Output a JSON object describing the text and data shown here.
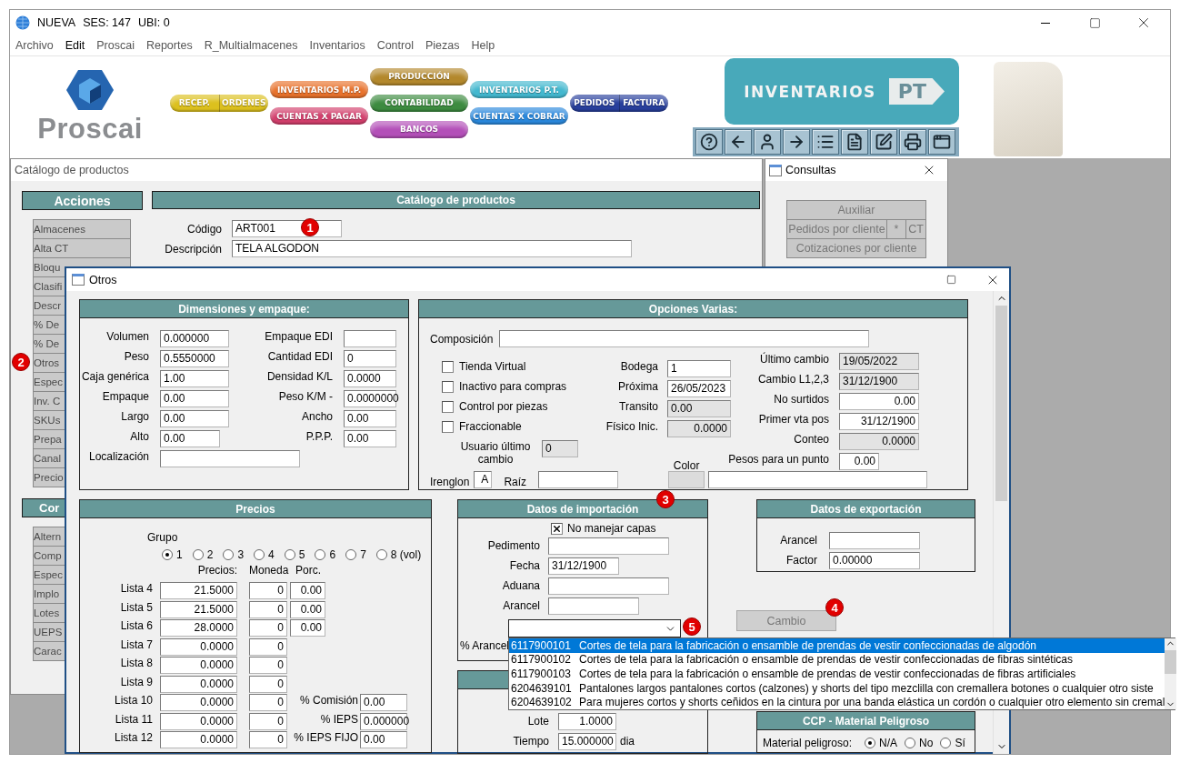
{
  "window": {
    "title": "NUEVA",
    "session": "SES: 147",
    "location": "UBI: 0"
  },
  "menu": [
    {
      "label": "Archivo",
      "disabled": true
    },
    {
      "label": "Edit",
      "disabled": false
    },
    {
      "label": "Proscai",
      "disabled": true
    },
    {
      "label": "Reportes",
      "disabled": true
    },
    {
      "label": "R_Multialmacenes",
      "disabled": true
    },
    {
      "label": "Inventarios",
      "disabled": true
    },
    {
      "label": "Control",
      "disabled": true
    },
    {
      "label": "Piezas",
      "disabled": true
    },
    {
      "label": "Help",
      "disabled": true
    }
  ],
  "logo": {
    "text": "Proscai"
  },
  "modules": [
    {
      "buttons": [
        {
          "labels": [
            "RECEP.",
            "ORDENES"
          ],
          "color": "#dcc01e"
        }
      ]
    },
    {
      "buttons": [
        {
          "labels": [
            "INVENTARIOS M.P."
          ],
          "color": "#e8722c"
        },
        {
          "labels": [
            "CUENTAS X PAGAR"
          ],
          "color": "#d23f6c"
        }
      ]
    },
    {
      "buttons": [
        {
          "labels": [
            "PRODUCCIÓN"
          ],
          "color": "#b3882c"
        },
        {
          "labels": [
            "CONTABILIDAD"
          ],
          "color": "#3d8b40"
        },
        {
          "labels": [
            "BANCOS"
          ],
          "color": "#b34fb8"
        }
      ]
    },
    {
      "buttons": [
        {
          "labels": [
            "INVENTARIOS P.T."
          ],
          "color": "#43b8cf"
        },
        {
          "labels": [
            "CUENTAS X COBRAR"
          ],
          "color": "#2a88dc"
        }
      ]
    },
    {
      "buttons": [
        {
          "labels": [
            "PEDIDOS",
            "FACTURA"
          ],
          "color": "#283f9c"
        }
      ]
    }
  ],
  "banner": {
    "title": "INVENTARIOS",
    "tag": "PT"
  },
  "catalog": {
    "title": "Catálogo de productos",
    "actions_header": "Acciones",
    "form_header": "Catálogo de productos",
    "actions": [
      {
        "label": "Almacenes"
      },
      {
        "label": "Alta CT"
      },
      {
        "label": "Bloqu"
      },
      {
        "label": "Clasifi"
      },
      {
        "label": "Descr"
      },
      {
        "label": "% De"
      },
      {
        "label": "% De"
      },
      {
        "label": "Otros",
        "badge": "2"
      },
      {
        "label": "Espec"
      },
      {
        "label": "Inv. C"
      },
      {
        "label": "SKUs"
      },
      {
        "label": "Prepa"
      },
      {
        "label": "Canal"
      },
      {
        "label": "Precio"
      }
    ],
    "second_header": "Cor",
    "second_actions": [
      {
        "label": "Altern"
      },
      {
        "label": "Comp"
      },
      {
        "label": "Espec"
      },
      {
        "label": "Implo"
      },
      {
        "label": "Lotes"
      },
      {
        "label": "UEPS"
      },
      {
        "label": "Carac"
      }
    ],
    "fields": [
      {
        "label": "Código",
        "value": "ART001",
        "badge": "1"
      },
      {
        "label": "Descripción",
        "value": "TELA ALGODON"
      }
    ]
  },
  "consultas": {
    "title": "Consultas",
    "rows": [
      [
        {
          "text": "Auxiliar"
        }
      ],
      [
        {
          "text": "Pedidos por cliente"
        },
        {
          "text": "*"
        },
        {
          "text": "CT"
        }
      ],
      [
        {
          "text": "Cotizaciones por cliente"
        }
      ]
    ]
  },
  "dialog": {
    "title": "Otros",
    "dimensions": {
      "title": "Dimensiones y empaque:",
      "left": [
        {
          "label": "Volumen",
          "value": "0.000000"
        },
        {
          "label": "Peso",
          "value": "0.5550000"
        },
        {
          "label": "Caja genérica",
          "value": "1.00"
        },
        {
          "label": "Empaque",
          "value": "0.00"
        },
        {
          "label": "Largo",
          "value": "0.00"
        },
        {
          "label": "Alto",
          "value": "0.00"
        }
      ],
      "right": [
        {
          "label": "Empaque EDI"
        },
        {
          "label": "Cantidad EDI",
          "value": "0"
        },
        {
          "label": "Densidad K/L",
          "value": "0.0000"
        },
        {
          "label": "Peso K/M -",
          "value": "0.0000000"
        },
        {
          "label": "Ancho",
          "value": "0.00"
        },
        {
          "label": "P.P.P.",
          "value": "0.00"
        }
      ],
      "location": {
        "label": "Localización"
      }
    },
    "options": {
      "title": "Opciones Varias:",
      "composition": {
        "label": "Composición"
      },
      "checks": [
        {
          "label": "Tienda Virtual",
          "checked": false
        },
        {
          "label": "Inactivo para compras",
          "checked": false
        },
        {
          "label": "Control por piezas",
          "checked": false
        },
        {
          "label": "Fraccionable",
          "checked": false
        }
      ],
      "user": {
        "label": "Usuario último cambio",
        "value": "0",
        "disabled": true
      },
      "middle": [
        {
          "label": "Bodega",
          "value": "1",
          "disabled": false
        },
        {
          "label": "Próxima",
          "value": "26/05/2023",
          "disabled": false
        },
        {
          "label": "Transito",
          "value": "0.00",
          "disabled": true
        },
        {
          "label": "Físico Inic.",
          "value": "0.0000",
          "disabled": true
        }
      ],
      "right": [
        {
          "label": "Último cambio",
          "value": "19/05/2022",
          "disabled": true
        },
        {
          "label": "Cambio L1,2,3",
          "value": "31/12/1900",
          "disabled": true
        },
        {
          "label": "No surtidos",
          "value": "0.00",
          "disabled": false
        },
        {
          "label": "Primer vta pos",
          "value": "31/12/1900",
          "disabled": false
        },
        {
          "label": "Conteo",
          "value": "0.0000",
          "disabled": true
        },
        {
          "label": "Pesos para un punto",
          "value": "0.00",
          "disabled": false
        }
      ],
      "irenglon": {
        "label": "Irenglon",
        "value": "A"
      },
      "root": {
        "label": "Raíz"
      },
      "color": {
        "label": "Color",
        "disabled": true
      }
    },
    "prices": {
      "title": "Precios",
      "group_label": "Grupo",
      "groups": [
        {
          "label": "1",
          "selected": true
        },
        {
          "label": "2",
          "selected": false
        },
        {
          "label": "3",
          "selected": false
        },
        {
          "label": "4",
          "selected": false
        },
        {
          "label": "5",
          "selected": false
        },
        {
          "label": "6",
          "selected": false
        },
        {
          "label": "7",
          "selected": false
        },
        {
          "label": "8 (vol)",
          "selected": false
        }
      ],
      "columns": [
        "Precios:",
        "Moneda",
        "Porc."
      ],
      "rows": [
        {
          "label": "Lista 4",
          "price": "21.5000",
          "currency": "0",
          "percent": "0.00"
        },
        {
          "label": "Lista 5",
          "price": "21.5000",
          "currency": "0",
          "percent": "0.00"
        },
        {
          "label": "Lista 6",
          "price": "28.0000",
          "currency": "0",
          "percent": "0.00"
        },
        {
          "label": "Lista 7",
          "price": "0.0000",
          "currency": "0"
        },
        {
          "label": "Lista 8",
          "price": "0.0000",
          "currency": "0"
        },
        {
          "label": "Lista 9",
          "price": "0.0000",
          "currency": "0"
        },
        {
          "label": "Lista 10",
          "price": "0.0000",
          "currency": "0",
          "extra": {
            "label": "% Comisión",
            "value": "0.00"
          }
        },
        {
          "label": "Lista 11",
          "price": "0.0000",
          "currency": "0",
          "extra": {
            "label": "% IEPS",
            "value": "0.000000"
          }
        },
        {
          "label": "Lista 12",
          "price": "0.0000",
          "currency": "0",
          "extra": {
            "label": "% IEPS FIJO",
            "value": "0.00"
          }
        }
      ]
    },
    "import": {
      "title": "Datos de importación",
      "badge": "3",
      "no_layers": {
        "label": "No manejar capas",
        "checked": true
      },
      "fields": [
        {
          "label": "Pedimento"
        },
        {
          "label": "Fecha",
          "value": "31/12/1900"
        },
        {
          "label": "Aduana"
        },
        {
          "label": "Arancel"
        }
      ],
      "tariff": {
        "label": "% Arancel",
        "badge": "5",
        "expanded": true,
        "options": [
          {
            "code": "6117900101",
            "text": "Cortes de tela para la fabricación o ensamble de prendas de vestir confeccionadas de algodón",
            "selected": true
          },
          {
            "code": "6117900102",
            "text": "Cortes de tela para la fabricación o ensamble de prendas de vestir confeccionadas de fibras sintéticas",
            "selected": false
          },
          {
            "code": "6117900103",
            "text": "Cortes de tela para la fabricación o ensamble de prendas de vestir confeccionadas de fibras artificiales",
            "selected": false
          },
          {
            "code": "6204639101",
            "text": "Pantalones largos pantalones cortos (calzones) y shorts del tipo mezclilla con cremallera botones o cualquier otro siste",
            "selected": false
          },
          {
            "code": "6204639102",
            "text": "Para mujeres cortos y shorts ceñidos en la cintura por una banda elástica un cordón o cualquier otro elemento sin cremal",
            "selected": false
          }
        ]
      }
    },
    "lot": {
      "fields": [
        {
          "label": "Lote",
          "value": "1.0000"
        },
        {
          "label": "Tiempo",
          "value": "15.000000",
          "unit": "dia"
        }
      ]
    },
    "export": {
      "title": "Datos de exportación",
      "fields": [
        {
          "label": "Arancel"
        },
        {
          "label": "Factor",
          "value": "0.00000"
        }
      ]
    },
    "change_button": {
      "label": "Cambio",
      "disabled": true,
      "badge": "4"
    },
    "hazard": {
      "title": "CCP - Material Peligroso",
      "label": "Material peligroso:",
      "options": [
        {
          "label": "N/A",
          "selected": true
        },
        {
          "label": "No",
          "selected": false
        },
        {
          "label": "Sí",
          "selected": false
        }
      ]
    }
  }
}
